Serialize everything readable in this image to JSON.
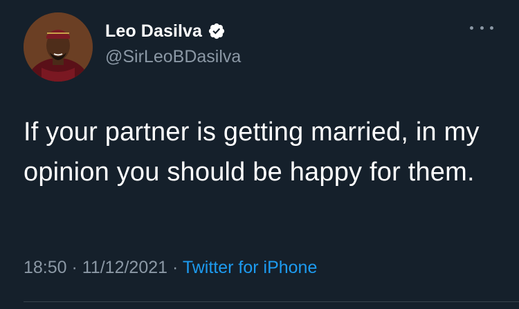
{
  "tweet": {
    "author": {
      "display_name": "Leo Dasilva",
      "handle": "@SirLeoBDasilva",
      "verified": true,
      "avatar_icon": "profile-photo"
    },
    "text": "If your partner is getting married, in my opinion you should be happy for them.",
    "meta": {
      "time": "18:50",
      "separator": " · ",
      "date": "11/12/2021",
      "source": "Twitter for iPhone"
    },
    "more_icon": "ellipsis-icon"
  },
  "colors": {
    "background": "#15202b",
    "primary_text": "#ffffff",
    "secondary_text": "#8b98a5",
    "accent": "#1d9bf0",
    "divider": "#38444d"
  }
}
